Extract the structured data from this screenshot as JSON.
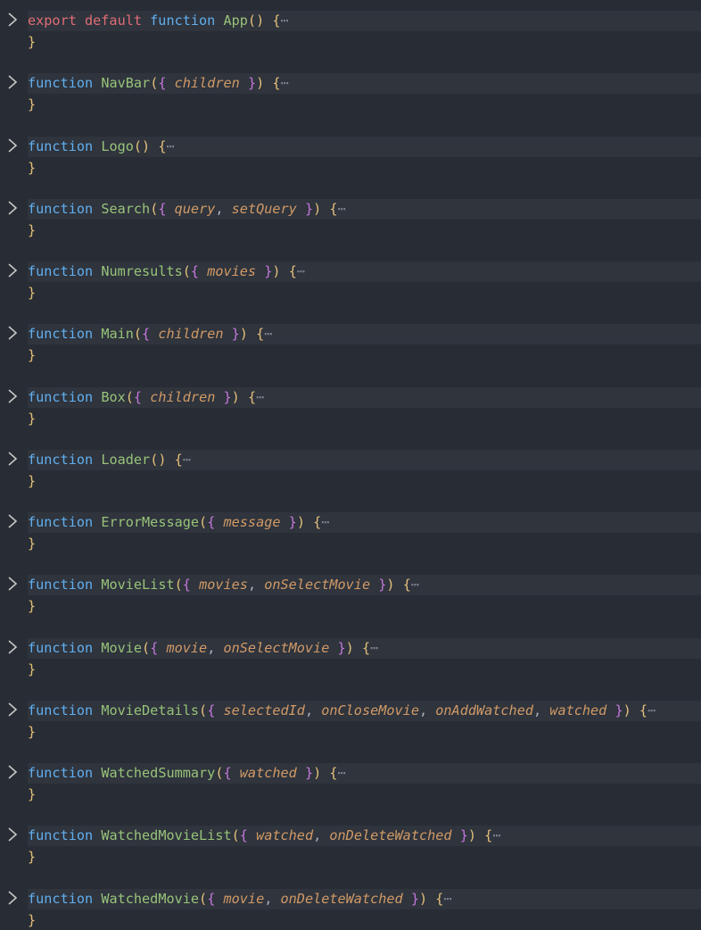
{
  "editor": {
    "blocks": [
      {
        "prefix": "export default ",
        "keyword": "function",
        "name": "App",
        "params": [],
        "fold": "⋯",
        "close": "}"
      },
      {
        "prefix": "",
        "keyword": "function",
        "name": "NavBar",
        "params": [
          "children"
        ],
        "fold": "⋯",
        "close": "}"
      },
      {
        "prefix": "",
        "keyword": "function",
        "name": "Logo",
        "params": [],
        "fold": "⋯",
        "close": "}"
      },
      {
        "prefix": "",
        "keyword": "function",
        "name": "Search",
        "params": [
          "query",
          "setQuery"
        ],
        "fold": "⋯",
        "close": "}"
      },
      {
        "prefix": "",
        "keyword": "function",
        "name": "Numresults",
        "params": [
          "movies"
        ],
        "fold": "⋯",
        "close": "}"
      },
      {
        "prefix": "",
        "keyword": "function",
        "name": "Main",
        "params": [
          "children"
        ],
        "fold": "⋯",
        "close": "}"
      },
      {
        "prefix": "",
        "keyword": "function",
        "name": "Box",
        "params": [
          "children"
        ],
        "fold": "⋯",
        "close": "}"
      },
      {
        "prefix": "",
        "keyword": "function",
        "name": "Loader",
        "params": [],
        "fold": "⋯",
        "close": "}"
      },
      {
        "prefix": "",
        "keyword": "function",
        "name": "ErrorMessage",
        "params": [
          "message"
        ],
        "fold": "⋯",
        "close": "}"
      },
      {
        "prefix": "",
        "keyword": "function",
        "name": "MovieList",
        "params": [
          "movies",
          "onSelectMovie"
        ],
        "fold": "⋯",
        "close": "}"
      },
      {
        "prefix": "",
        "keyword": "function",
        "name": "Movie",
        "params": [
          "movie",
          "onSelectMovie"
        ],
        "fold": "⋯",
        "close": "}"
      },
      {
        "prefix": "",
        "keyword": "function",
        "name": "MovieDetails",
        "params": [
          "selectedId",
          "onCloseMovie",
          "onAddWatched",
          "watched"
        ],
        "fold": "⋯",
        "close": "}"
      },
      {
        "prefix": "",
        "keyword": "function",
        "name": "WatchedSummary",
        "params": [
          "watched"
        ],
        "fold": "⋯",
        "close": "}"
      },
      {
        "prefix": "",
        "keyword": "function",
        "name": "WatchedMovieList",
        "params": [
          "watched",
          "onDeleteWatched"
        ],
        "fold": "⋯",
        "close": "}"
      },
      {
        "prefix": "",
        "keyword": "function",
        "name": "WatchedMovie",
        "params": [
          "movie",
          "onDeleteWatched"
        ],
        "fold": "⋯",
        "close": "}"
      }
    ],
    "colors": {
      "background": "#282c34",
      "line_highlight": "#2f343d",
      "export_default": "#e06c75",
      "function_keyword": "#61afef",
      "function_name": "#98c379",
      "paren": "#e5c07b",
      "destructure_brace": "#c678dd",
      "param": "#d19a66",
      "fold_ellipsis": "#7f848e"
    },
    "icons": {
      "fold_toggle": "chevron-right-icon"
    }
  }
}
